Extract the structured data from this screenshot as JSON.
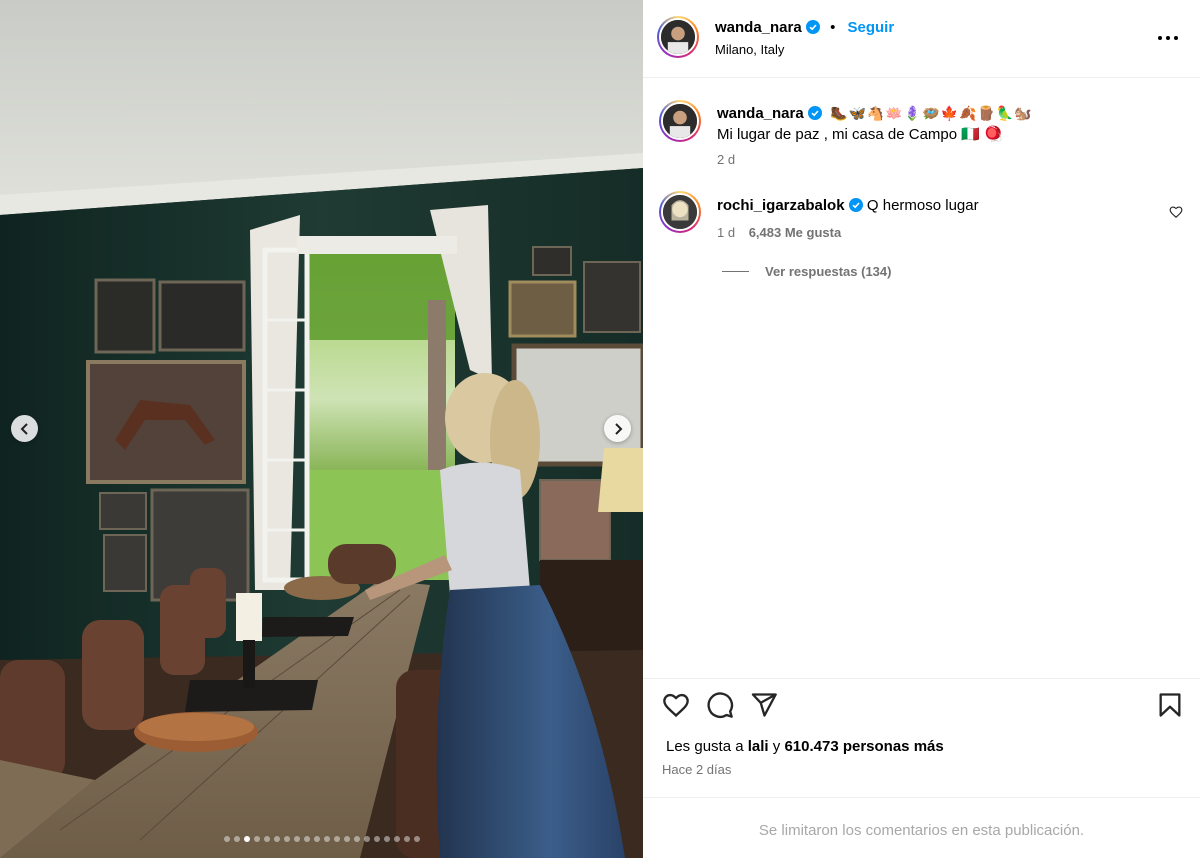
{
  "post": {
    "username": "wanda_nara",
    "follow_label": "Seguir",
    "dot": "•",
    "location": "Milano, Italy",
    "more_icon": "more-horizontal-icon"
  },
  "caption": {
    "username": "wanda_nara",
    "emojis": "🥾🦋🐴🪷🪻🪺🍁🍂🪵🦜🐿️",
    "text": "Mi lugar de paz , mi casa de Campo 🇮🇹 🪀",
    "time": "2 d"
  },
  "comment": {
    "username": "rochi_igarzabalok",
    "text": "Q hermoso lugar",
    "time": "1 d",
    "likes": "6,483 Me gusta",
    "replies_label": "Ver respuestas (134)"
  },
  "actions": {
    "likes_prefix": "Les gusta a",
    "likes_user": "lali",
    "likes_and": "y",
    "likes_rest": "610.473 personas más",
    "post_time": "Hace 2 días",
    "comments_disabled": "Se limitaron los comentarios en esta publicación."
  },
  "carousel": {
    "slide_count": 20,
    "active_index": 2
  },
  "colors": {
    "link_blue": "#0095f6",
    "muted_text": "#737373",
    "verified_blue": "#0095f6",
    "wall_green": "#1f3b33"
  }
}
